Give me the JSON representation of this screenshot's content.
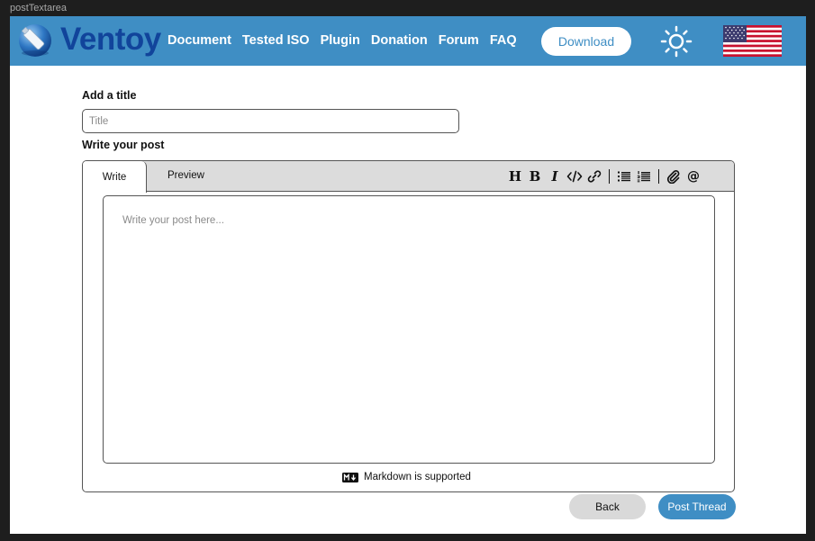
{
  "frame": {
    "label": "postTextarea"
  },
  "navbar": {
    "logo_text": "Ventoy",
    "links": [
      "Document",
      "Tested ISO",
      "Plugin",
      "Donation",
      "Forum",
      "FAQ"
    ],
    "download_label": "Download",
    "theme_icon": "sun-icon",
    "language_icon": "us-flag-icon",
    "colors": {
      "bar": "#3f8ec4",
      "logo": "#11449b"
    }
  },
  "form": {
    "title_label": "Add a title",
    "title_placeholder": "Title",
    "post_label": "Write your post",
    "tabs": {
      "write": "Write",
      "preview": "Preview"
    },
    "toolbar_icons": [
      "heading-icon",
      "bold-icon",
      "italic-icon",
      "code-icon",
      "link-icon",
      "bulleted-list-icon",
      "numbered-list-icon",
      "attach-icon",
      "mention-icon"
    ],
    "body_placeholder": "Write your post here...",
    "markdown_note": "Markdown is supported",
    "back_label": "Back",
    "submit_label": "Post Thread"
  }
}
